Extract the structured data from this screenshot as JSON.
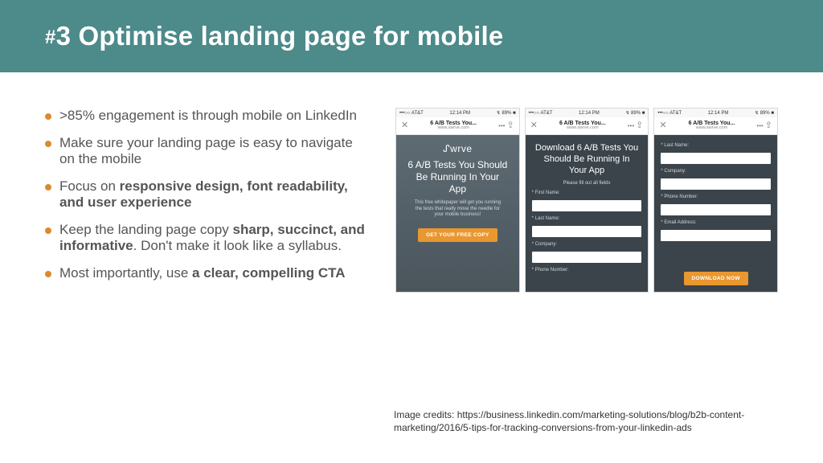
{
  "header": {
    "hash": "#",
    "title": "3 Optimise landing page for mobile"
  },
  "bullets": {
    "b1": ">85% engagement is through mobile on LinkedIn",
    "b2": "Make sure your landing page is easy to navigate on the mobile",
    "b3a": "Focus on ",
    "b3b": "responsive design, font readability, and user experience",
    "b4a": "Keep the landing page copy ",
    "b4b": "sharp, succinct, and informative",
    "b4c": ". Don't make it look like a syllabus.",
    "b5a": "Most importantly, use ",
    "b5b": "a clear, compelling CTA"
  },
  "status": {
    "carrier": "•••○○ AT&T",
    "wifi": "ᯤ",
    "time": "12:14 PM",
    "battery": "↯ 89% ■"
  },
  "nav": {
    "close": "✕",
    "title": "6 A/B Tests You...",
    "sub": "www.swrve.com",
    "more": "•••",
    "share": "⇪"
  },
  "phone1": {
    "brand": "ᔑwrve",
    "title": "6 A/B Tests You Should Be Running In Your App",
    "sub": "This free whitepaper will get you running the tests that really move the needle for your mobile business!",
    "cta": "GET YOUR FREE COPY"
  },
  "phone2": {
    "title": "Download 6 A/B Tests You Should Be Running In Your App",
    "sub": "Please fill out all fields",
    "f1": "* First Name:",
    "f2": "* Last Name:",
    "f3": "* Company:",
    "f4": "* Phone Number:"
  },
  "phone3": {
    "f1": "* Last Name:",
    "f2": "* Company:",
    "f3": "* Phone Number:",
    "f4": "* Email Address:",
    "cta": "DOWNLOAD NOW"
  },
  "credits": "Image credits:  https://business.linkedin.com/marketing-solutions/blog/b2b-content-marketing/2016/5-tips-for-tracking-conversions-from-your-linkedin-ads"
}
